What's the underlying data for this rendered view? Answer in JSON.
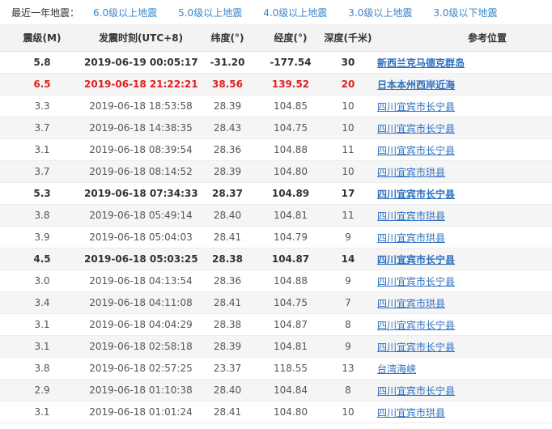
{
  "filters": {
    "label": "最近一年地震：",
    "links": [
      "6.0级以上地震",
      "5.0级以上地震",
      "4.0级以上地震",
      "3.0级以上地震",
      "3.0级以下地震"
    ]
  },
  "table": {
    "headers": {
      "magnitude": "震级(M)",
      "time": "发震时刻(UTC+8)",
      "lat": "纬度(°)",
      "lon": "经度(°)",
      "depth": "深度(千米)",
      "location": "参考位置"
    },
    "rows": [
      {
        "m": "5.8",
        "t": "2019-06-19 00:05:17",
        "lat": "-31.20",
        "lon": "-177.54",
        "d": "30",
        "loc": "新西兰克马德克群岛",
        "style": "bold"
      },
      {
        "m": "6.5",
        "t": "2019-06-18 21:22:21",
        "lat": "38.56",
        "lon": "139.52",
        "d": "20",
        "loc": "日本本州西岸近海",
        "style": "red"
      },
      {
        "m": "3.3",
        "t": "2019-06-18 18:53:58",
        "lat": "28.39",
        "lon": "104.85",
        "d": "10",
        "loc": "四川宜宾市长宁县",
        "style": "normal"
      },
      {
        "m": "3.7",
        "t": "2019-06-18 14:38:35",
        "lat": "28.43",
        "lon": "104.75",
        "d": "10",
        "loc": "四川宜宾市长宁县",
        "style": "normal"
      },
      {
        "m": "3.1",
        "t": "2019-06-18 08:39:54",
        "lat": "28.36",
        "lon": "104.88",
        "d": "11",
        "loc": "四川宜宾市长宁县",
        "style": "normal"
      },
      {
        "m": "3.7",
        "t": "2019-06-18 08:14:52",
        "lat": "28.39",
        "lon": "104.80",
        "d": "10",
        "loc": "四川宜宾市珙县",
        "style": "normal"
      },
      {
        "m": "5.3",
        "t": "2019-06-18 07:34:33",
        "lat": "28.37",
        "lon": "104.89",
        "d": "17",
        "loc": "四川宜宾市长宁县",
        "style": "bold"
      },
      {
        "m": "3.8",
        "t": "2019-06-18 05:49:14",
        "lat": "28.40",
        "lon": "104.81",
        "d": "11",
        "loc": "四川宜宾市珙县",
        "style": "normal"
      },
      {
        "m": "3.9",
        "t": "2019-06-18 05:04:03",
        "lat": "28.41",
        "lon": "104.79",
        "d": "9",
        "loc": "四川宜宾市珙县",
        "style": "normal"
      },
      {
        "m": "4.5",
        "t": "2019-06-18 05:03:25",
        "lat": "28.38",
        "lon": "104.87",
        "d": "14",
        "loc": "四川宜宾市长宁县",
        "style": "bold"
      },
      {
        "m": "3.0",
        "t": "2019-06-18 04:13:54",
        "lat": "28.36",
        "lon": "104.88",
        "d": "9",
        "loc": "四川宜宾市长宁县",
        "style": "normal"
      },
      {
        "m": "3.4",
        "t": "2019-06-18 04:11:08",
        "lat": "28.41",
        "lon": "104.75",
        "d": "7",
        "loc": "四川宜宾市珙县",
        "style": "normal"
      },
      {
        "m": "3.1",
        "t": "2019-06-18 04:04:29",
        "lat": "28.38",
        "lon": "104.87",
        "d": "8",
        "loc": "四川宜宾市长宁县",
        "style": "normal"
      },
      {
        "m": "3.1",
        "t": "2019-06-18 02:58:18",
        "lat": "28.39",
        "lon": "104.81",
        "d": "9",
        "loc": "四川宜宾市长宁县",
        "style": "normal"
      },
      {
        "m": "3.8",
        "t": "2019-06-18 02:57:25",
        "lat": "23.37",
        "lon": "118.55",
        "d": "13",
        "loc": "台湾海峡",
        "style": "normal"
      },
      {
        "m": "2.9",
        "t": "2019-06-18 01:10:38",
        "lat": "28.40",
        "lon": "104.84",
        "d": "8",
        "loc": "四川宜宾市长宁县",
        "style": "normal"
      },
      {
        "m": "3.1",
        "t": "2019-06-18 01:01:24",
        "lat": "28.41",
        "lon": "104.80",
        "d": "10",
        "loc": "四川宜宾市珙县",
        "style": "normal"
      }
    ]
  }
}
